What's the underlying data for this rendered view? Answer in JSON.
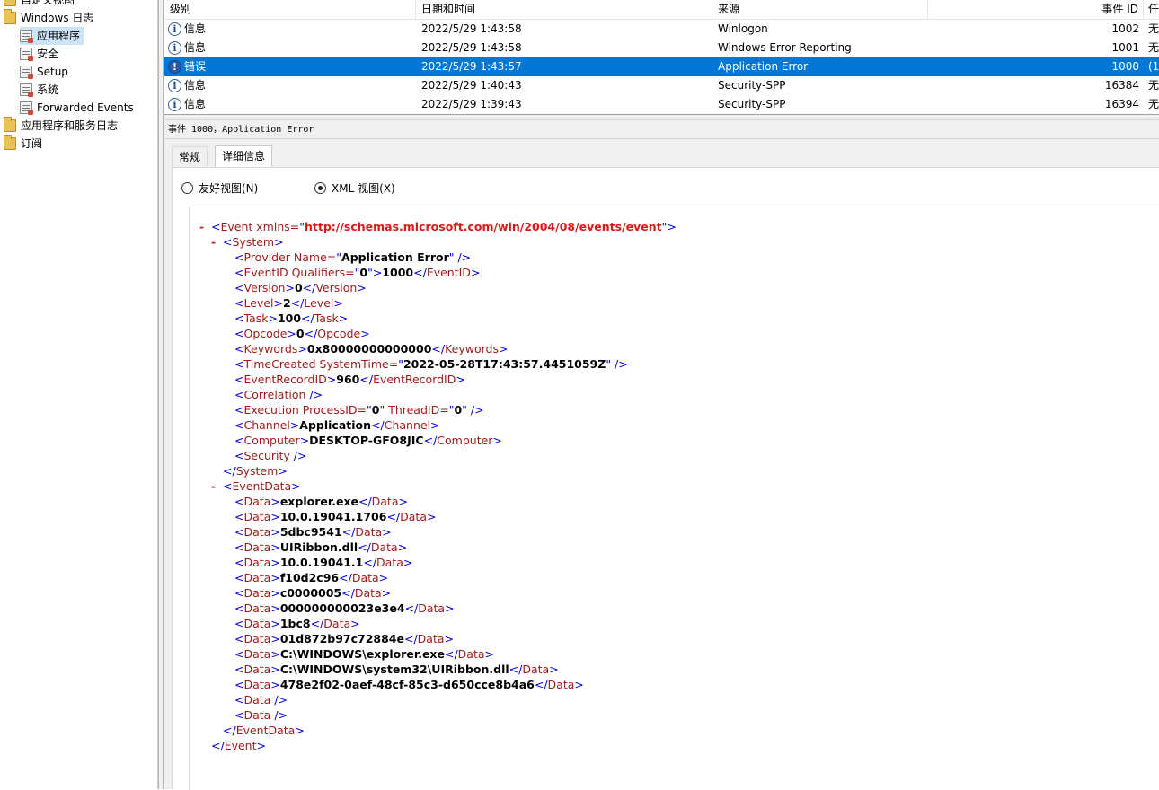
{
  "tree": {
    "items": [
      {
        "label": "自定义视图",
        "icon": "folder-icon"
      },
      {
        "label": "Windows 日志",
        "icon": "folder-icon"
      },
      {
        "label": "应用程序",
        "icon": "log-icon",
        "selected": true
      },
      {
        "label": "安全",
        "icon": "log-icon"
      },
      {
        "label": "Setup",
        "icon": "log-icon"
      },
      {
        "label": "系统",
        "icon": "log-icon"
      },
      {
        "label": "Forwarded Events",
        "icon": "log-icon"
      },
      {
        "label": "应用程序和服务日志",
        "icon": "folder-icon"
      },
      {
        "label": "订阅",
        "icon": "folder-icon"
      }
    ]
  },
  "grid": {
    "columns": [
      "级别",
      "日期和时间",
      "来源",
      "事件 ID",
      "任"
    ],
    "rows": [
      {
        "level": "信息",
        "datetime": "2022/5/29 1:43:58",
        "source": "Winlogon",
        "event_id": "1002",
        "task": "无"
      },
      {
        "level": "信息",
        "datetime": "2022/5/29 1:43:58",
        "source": "Windows Error Reporting",
        "event_id": "1001",
        "task": "无"
      },
      {
        "level": "错误",
        "datetime": "2022/5/29 1:43:57",
        "source": "Application Error",
        "event_id": "1000",
        "task": "(1",
        "selected": true
      },
      {
        "level": "信息",
        "datetime": "2022/5/29 1:40:43",
        "source": "Security-SPP",
        "event_id": "16384",
        "task": "无"
      },
      {
        "level": "信息",
        "datetime": "2022/5/29 1:39:43",
        "source": "Security-SPP",
        "event_id": "16394",
        "task": "无"
      }
    ]
  },
  "detail": {
    "title": "事件 1000，Application Error",
    "tabs": [
      "常规",
      "详细信息"
    ],
    "active_tab": "详细信息",
    "radio_friendly": "友好视图(N)",
    "radio_xml": "XML 视图(X)",
    "xml_selected": true
  },
  "xml": {
    "event_xmlns": "http://schemas.microsoft.com/win/2004/08/events/event",
    "provider_name": "Application Error",
    "event_id_qualifiers": "0",
    "event_id": "1000",
    "version": "0",
    "level": "2",
    "task": "100",
    "opcode": "0",
    "keywords": "0x80000000000000",
    "time_created": "2022-05-28T17:43:57.4451059Z",
    "event_record_id": "960",
    "process_id": "0",
    "thread_id": "0",
    "channel": "Application",
    "computer": "DESKTOP-GFO8JIC",
    "data": [
      "explorer.exe",
      "10.0.19041.1706",
      "5dbc9541",
      "UIRibbon.dll",
      "10.0.19041.1",
      "f10d2c96",
      "c0000005",
      "000000000023e3e4",
      "1bc8",
      "01d872b97c72884e",
      "C:\\WINDOWS\\explorer.exe",
      "C:\\WINDOWS\\system32\\UIRibbon.dll",
      "478e2f02-0aef-48cf-85c3-d650cce8b4a6"
    ]
  },
  "colors": {
    "selection": "#0078d7",
    "tag": "#9b1b1b",
    "bracket": "#0000cc",
    "namespace": "#d41a1a"
  }
}
